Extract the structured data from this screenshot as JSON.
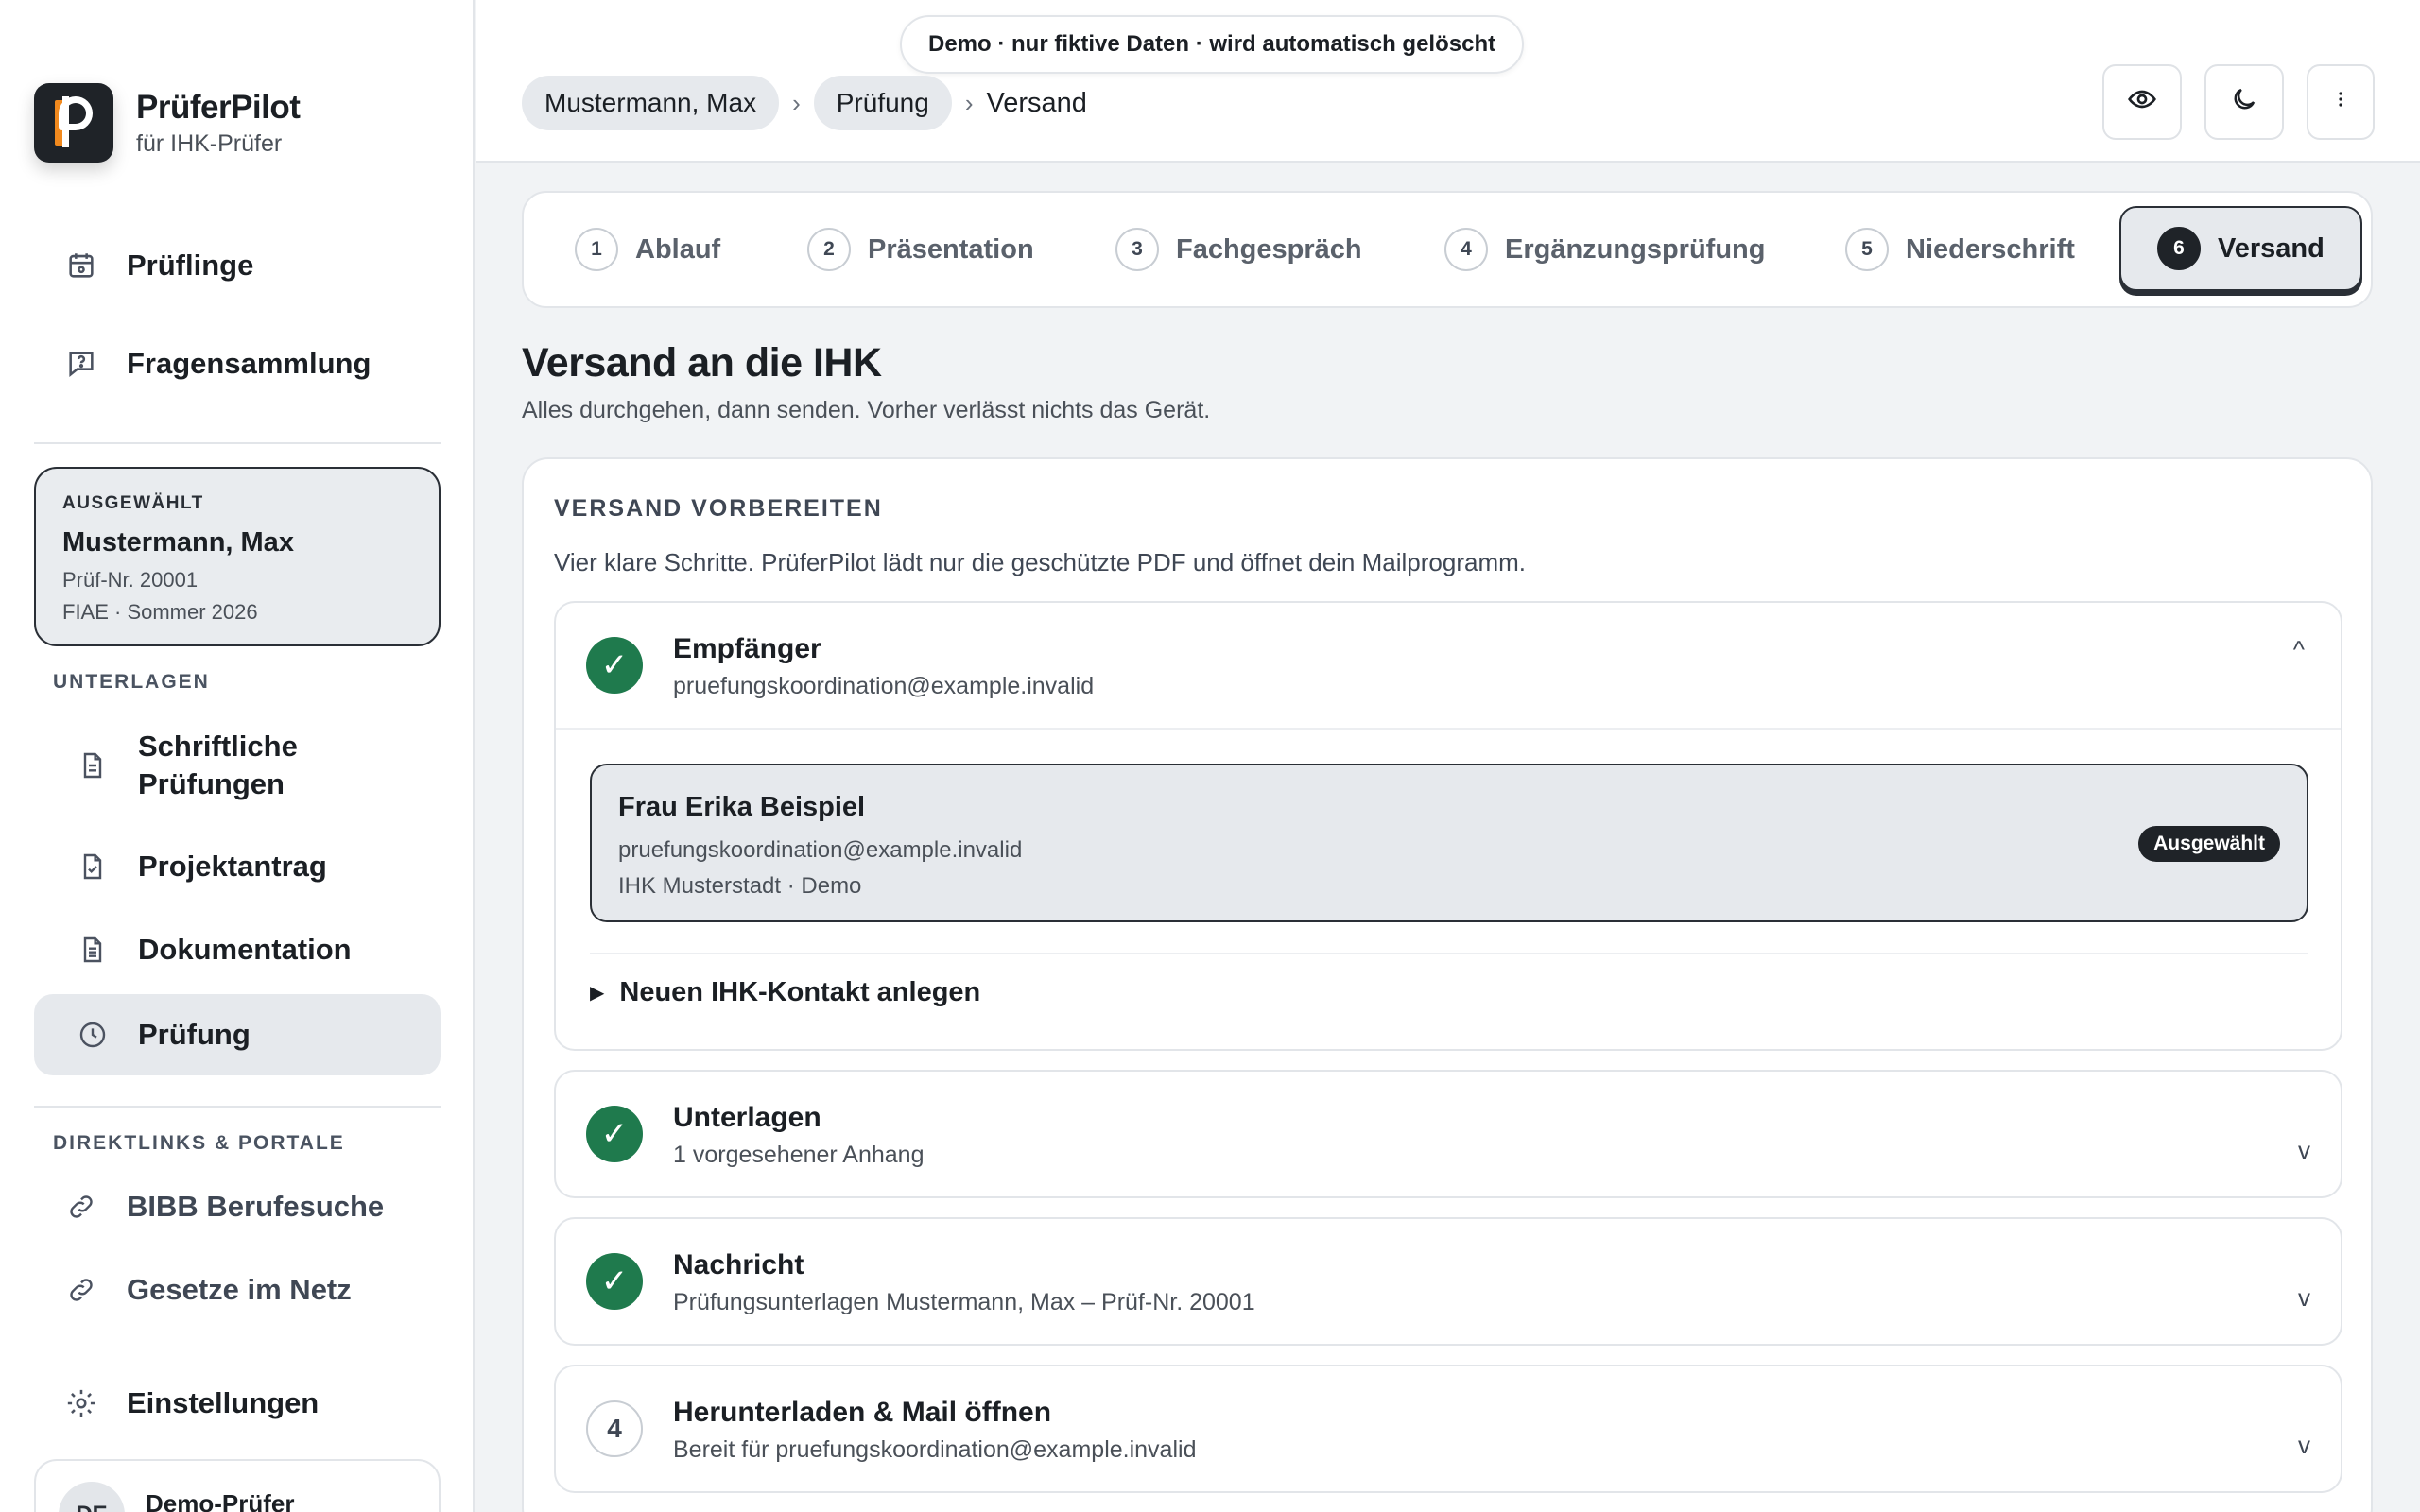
{
  "brand": {
    "name": "PrüferPilot",
    "subtitle": "für IHK-Prüfer"
  },
  "sidebar": {
    "top_items": [
      {
        "label": "Prüflinge",
        "icon": "calendar-icon"
      },
      {
        "label": "Fragensammlung",
        "icon": "chat-question-icon"
      }
    ],
    "selected": {
      "tag": "AUSGEWÄHLT",
      "name": "Mustermann, Max",
      "id": "Prüf-Nr. 20001",
      "info": "FIAE · Sommer 2026"
    },
    "unterlagen_label": "UNTERLAGEN",
    "unterlagen_items": [
      {
        "label": "Schriftliche Prüfungen",
        "icon": "document-icon"
      },
      {
        "label": "Projektantrag",
        "icon": "document-check-icon"
      },
      {
        "label": "Dokumentation",
        "icon": "document-lines-icon"
      },
      {
        "label": "Prüfung",
        "icon": "clock-icon",
        "active": true
      }
    ],
    "links_label": "DIREKTLINKS & PORTALE",
    "links": [
      {
        "label": "BIBB Berufesuche",
        "icon": "link-icon"
      },
      {
        "label": "Gesetze im Netz",
        "icon": "link-icon"
      }
    ],
    "settings_label": "Einstellungen",
    "user": {
      "initials": "DE",
      "name": "Demo-Prüfer"
    }
  },
  "topbar": {
    "demo_notice": "Demo · nur fiktive Daten · wird automatisch gelöscht",
    "breadcrumbs": [
      "Mustermann, Max",
      "Prüfung",
      "Versand"
    ],
    "buttons": [
      "eye-icon",
      "moon-icon",
      "more-vertical-icon"
    ]
  },
  "steps": [
    {
      "num": "1",
      "label": "Ablauf"
    },
    {
      "num": "2",
      "label": "Präsentation"
    },
    {
      "num": "3",
      "label": "Fachgespräch"
    },
    {
      "num": "4",
      "label": "Ergänzungsprüfung"
    },
    {
      "num": "5",
      "label": "Niederschrift"
    },
    {
      "num": "6",
      "label": "Versand",
      "active": true
    }
  ],
  "page": {
    "title": "Versand an die IHK",
    "subtitle": "Alles durchgehen, dann senden. Vorher verlässt nichts das Gerät."
  },
  "prepare": {
    "heading": "VERSAND VORBEREITEN",
    "description": "Vier klare Schritte. PrüferPilot lädt nur die geschützte PDF und öffnet dein Mailprogramm.",
    "sections": [
      {
        "title": "Empfänger",
        "subtitle": "pruefungskoordination@example.invalid",
        "done": true,
        "expanded": true,
        "chevron": "^"
      },
      {
        "title": "Unterlagen",
        "subtitle": "1 vorgesehener Anhang",
        "done": true,
        "chevron": "v"
      },
      {
        "title": "Nachricht",
        "subtitle": "Prüfungsunterlagen Mustermann, Max – Prüf-Nr. 20001",
        "done": true,
        "chevron": "v"
      },
      {
        "title": "Herunterladen & Mail öffnen",
        "subtitle": "Bereit für pruefungskoordination@example.invalid",
        "done": false,
        "num": "4",
        "chevron": "v"
      }
    ],
    "contact": {
      "name": "Frau Erika Beispiel",
      "email": "pruefungskoordination@example.invalid",
      "org": "IHK Musterstadt · Demo",
      "badge": "Ausgewählt"
    },
    "new_contact": "Neuen IHK-Kontakt anlegen",
    "check_mark": "✓"
  }
}
